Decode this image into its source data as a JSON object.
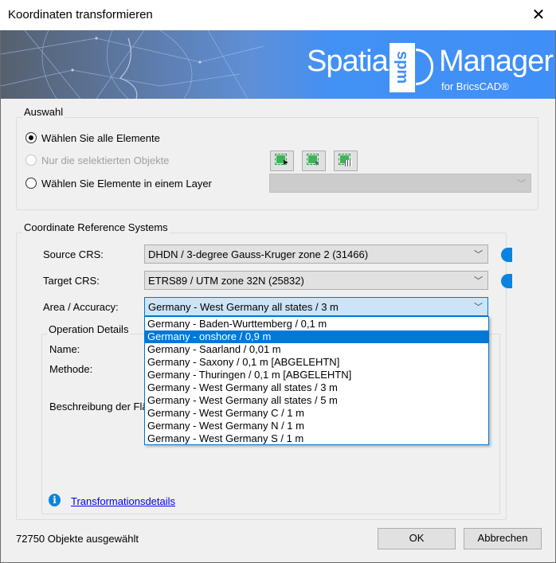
{
  "window": {
    "title": "Koordinaten transformieren"
  },
  "banner": {
    "logo_word1": "Spatial",
    "logo_mark": "spm",
    "logo_word2": "Manager",
    "logo_sub": "for BricsCAD®"
  },
  "selection": {
    "group_label": "Auswahl",
    "options": [
      {
        "label": "Wählen Sie alle Elemente",
        "checked": true,
        "enabled": true
      },
      {
        "label": "Nur die selektierten Objekte",
        "checked": false,
        "enabled": false
      },
      {
        "label": "Wählen Sie Elemente in einem Layer",
        "checked": false,
        "enabled": true
      }
    ],
    "tool_buttons": [
      "select-objects-icon",
      "filter-selection-icon",
      "select-by-table-icon"
    ],
    "layer_value": ""
  },
  "crs": {
    "group_label": "Coordinate Reference Systems",
    "source_label": "Source CRS:",
    "source_value": "DHDN / 3-degree Gauss-Kruger zone 2 (31466)",
    "target_label": "Target CRS:",
    "target_value": "ETRS89 / UTM zone 32N (25832)",
    "area_label": "Area / Accuracy:",
    "area_value": "Germany - West Germany all states / 3 m",
    "area_options": [
      "Germany - Baden-Wurttemberg / 0,1 m",
      "Germany - onshore / 0,9 m",
      "Germany - Saarland / 0,01 m",
      "Germany - Saxony / 0,1 m [ABGELEHTN]",
      "Germany - Thuringen / 0,1 m [ABGELEHTN]",
      "Germany - West Germany all states / 3 m",
      "Germany - West Germany all states / 5 m",
      "Germany - West Germany C / 1 m",
      "Germany - West Germany N / 1 m",
      "Germany - West Germany S / 1 m"
    ],
    "area_highlighted": "Germany - onshore / 0,9 m"
  },
  "operation": {
    "group_label": "Operation Details",
    "name_label": "Name:",
    "method_label": "Methode:",
    "description_label": "Beschreibung der Flä",
    "details_link": "Transformationsdetails"
  },
  "footer": {
    "status": "72750 Objekte ausgewählt",
    "ok": "OK",
    "cancel": "Abbrechen"
  },
  "colors": {
    "accent": "#0078d7",
    "banner_blue": "#3f8ff8",
    "highlight": "#cce4f7"
  }
}
